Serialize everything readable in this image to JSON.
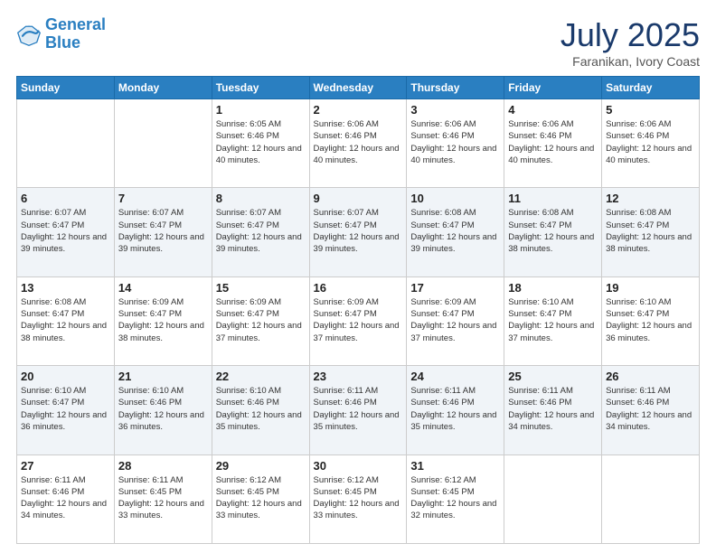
{
  "header": {
    "logo_line1": "General",
    "logo_line2": "Blue",
    "month": "July 2025",
    "location": "Faranikan, Ivory Coast"
  },
  "days_of_week": [
    "Sunday",
    "Monday",
    "Tuesday",
    "Wednesday",
    "Thursday",
    "Friday",
    "Saturday"
  ],
  "weeks": [
    [
      {
        "day": "",
        "sunrise": "",
        "sunset": "",
        "daylight": ""
      },
      {
        "day": "",
        "sunrise": "",
        "sunset": "",
        "daylight": ""
      },
      {
        "day": "1",
        "sunrise": "Sunrise: 6:05 AM",
        "sunset": "Sunset: 6:46 PM",
        "daylight": "Daylight: 12 hours and 40 minutes."
      },
      {
        "day": "2",
        "sunrise": "Sunrise: 6:06 AM",
        "sunset": "Sunset: 6:46 PM",
        "daylight": "Daylight: 12 hours and 40 minutes."
      },
      {
        "day": "3",
        "sunrise": "Sunrise: 6:06 AM",
        "sunset": "Sunset: 6:46 PM",
        "daylight": "Daylight: 12 hours and 40 minutes."
      },
      {
        "day": "4",
        "sunrise": "Sunrise: 6:06 AM",
        "sunset": "Sunset: 6:46 PM",
        "daylight": "Daylight: 12 hours and 40 minutes."
      },
      {
        "day": "5",
        "sunrise": "Sunrise: 6:06 AM",
        "sunset": "Sunset: 6:46 PM",
        "daylight": "Daylight: 12 hours and 40 minutes."
      }
    ],
    [
      {
        "day": "6",
        "sunrise": "Sunrise: 6:07 AM",
        "sunset": "Sunset: 6:47 PM",
        "daylight": "Daylight: 12 hours and 39 minutes."
      },
      {
        "day": "7",
        "sunrise": "Sunrise: 6:07 AM",
        "sunset": "Sunset: 6:47 PM",
        "daylight": "Daylight: 12 hours and 39 minutes."
      },
      {
        "day": "8",
        "sunrise": "Sunrise: 6:07 AM",
        "sunset": "Sunset: 6:47 PM",
        "daylight": "Daylight: 12 hours and 39 minutes."
      },
      {
        "day": "9",
        "sunrise": "Sunrise: 6:07 AM",
        "sunset": "Sunset: 6:47 PM",
        "daylight": "Daylight: 12 hours and 39 minutes."
      },
      {
        "day": "10",
        "sunrise": "Sunrise: 6:08 AM",
        "sunset": "Sunset: 6:47 PM",
        "daylight": "Daylight: 12 hours and 39 minutes."
      },
      {
        "day": "11",
        "sunrise": "Sunrise: 6:08 AM",
        "sunset": "Sunset: 6:47 PM",
        "daylight": "Daylight: 12 hours and 38 minutes."
      },
      {
        "day": "12",
        "sunrise": "Sunrise: 6:08 AM",
        "sunset": "Sunset: 6:47 PM",
        "daylight": "Daylight: 12 hours and 38 minutes."
      }
    ],
    [
      {
        "day": "13",
        "sunrise": "Sunrise: 6:08 AM",
        "sunset": "Sunset: 6:47 PM",
        "daylight": "Daylight: 12 hours and 38 minutes."
      },
      {
        "day": "14",
        "sunrise": "Sunrise: 6:09 AM",
        "sunset": "Sunset: 6:47 PM",
        "daylight": "Daylight: 12 hours and 38 minutes."
      },
      {
        "day": "15",
        "sunrise": "Sunrise: 6:09 AM",
        "sunset": "Sunset: 6:47 PM",
        "daylight": "Daylight: 12 hours and 37 minutes."
      },
      {
        "day": "16",
        "sunrise": "Sunrise: 6:09 AM",
        "sunset": "Sunset: 6:47 PM",
        "daylight": "Daylight: 12 hours and 37 minutes."
      },
      {
        "day": "17",
        "sunrise": "Sunrise: 6:09 AM",
        "sunset": "Sunset: 6:47 PM",
        "daylight": "Daylight: 12 hours and 37 minutes."
      },
      {
        "day": "18",
        "sunrise": "Sunrise: 6:10 AM",
        "sunset": "Sunset: 6:47 PM",
        "daylight": "Daylight: 12 hours and 37 minutes."
      },
      {
        "day": "19",
        "sunrise": "Sunrise: 6:10 AM",
        "sunset": "Sunset: 6:47 PM",
        "daylight": "Daylight: 12 hours and 36 minutes."
      }
    ],
    [
      {
        "day": "20",
        "sunrise": "Sunrise: 6:10 AM",
        "sunset": "Sunset: 6:47 PM",
        "daylight": "Daylight: 12 hours and 36 minutes."
      },
      {
        "day": "21",
        "sunrise": "Sunrise: 6:10 AM",
        "sunset": "Sunset: 6:46 PM",
        "daylight": "Daylight: 12 hours and 36 minutes."
      },
      {
        "day": "22",
        "sunrise": "Sunrise: 6:10 AM",
        "sunset": "Sunset: 6:46 PM",
        "daylight": "Daylight: 12 hours and 35 minutes."
      },
      {
        "day": "23",
        "sunrise": "Sunrise: 6:11 AM",
        "sunset": "Sunset: 6:46 PM",
        "daylight": "Daylight: 12 hours and 35 minutes."
      },
      {
        "day": "24",
        "sunrise": "Sunrise: 6:11 AM",
        "sunset": "Sunset: 6:46 PM",
        "daylight": "Daylight: 12 hours and 35 minutes."
      },
      {
        "day": "25",
        "sunrise": "Sunrise: 6:11 AM",
        "sunset": "Sunset: 6:46 PM",
        "daylight": "Daylight: 12 hours and 34 minutes."
      },
      {
        "day": "26",
        "sunrise": "Sunrise: 6:11 AM",
        "sunset": "Sunset: 6:46 PM",
        "daylight": "Daylight: 12 hours and 34 minutes."
      }
    ],
    [
      {
        "day": "27",
        "sunrise": "Sunrise: 6:11 AM",
        "sunset": "Sunset: 6:46 PM",
        "daylight": "Daylight: 12 hours and 34 minutes."
      },
      {
        "day": "28",
        "sunrise": "Sunrise: 6:11 AM",
        "sunset": "Sunset: 6:45 PM",
        "daylight": "Daylight: 12 hours and 33 minutes."
      },
      {
        "day": "29",
        "sunrise": "Sunrise: 6:12 AM",
        "sunset": "Sunset: 6:45 PM",
        "daylight": "Daylight: 12 hours and 33 minutes."
      },
      {
        "day": "30",
        "sunrise": "Sunrise: 6:12 AM",
        "sunset": "Sunset: 6:45 PM",
        "daylight": "Daylight: 12 hours and 33 minutes."
      },
      {
        "day": "31",
        "sunrise": "Sunrise: 6:12 AM",
        "sunset": "Sunset: 6:45 PM",
        "daylight": "Daylight: 12 hours and 32 minutes."
      },
      {
        "day": "",
        "sunrise": "",
        "sunset": "",
        "daylight": ""
      },
      {
        "day": "",
        "sunrise": "",
        "sunset": "",
        "daylight": ""
      }
    ]
  ]
}
